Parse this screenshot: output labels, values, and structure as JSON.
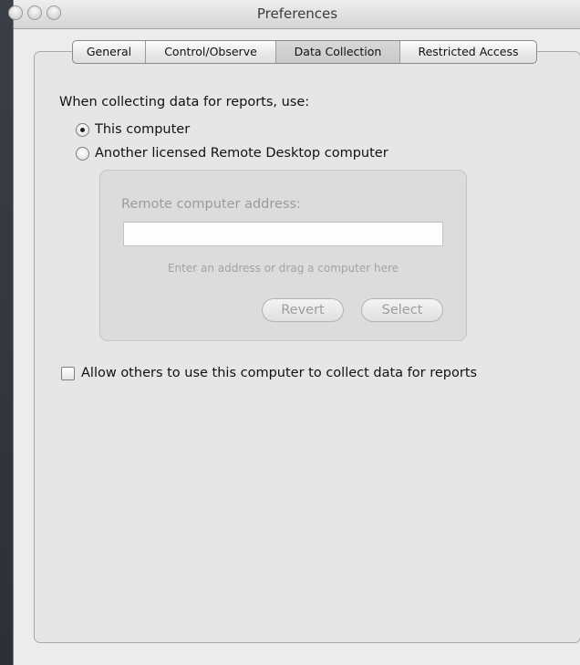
{
  "window": {
    "title": "Preferences"
  },
  "tabs": [
    {
      "label": "General",
      "active": false
    },
    {
      "label": "Control/Observe",
      "active": false
    },
    {
      "label": "Data Collection",
      "active": true
    },
    {
      "label": "Restricted Access",
      "active": false
    }
  ],
  "data_collection": {
    "heading": "When collecting data for reports, use:",
    "options": [
      {
        "label": "This computer",
        "selected": true
      },
      {
        "label": "Another licensed Remote Desktop computer",
        "selected": false
      }
    ],
    "remote": {
      "label": "Remote computer address:",
      "value": "",
      "hint": "Enter an address or drag a computer here",
      "revert_label": "Revert",
      "select_label": "Select",
      "enabled": false
    },
    "allow_others": {
      "label": "Allow others to use this computer to collect data for reports",
      "checked": false
    }
  }
}
